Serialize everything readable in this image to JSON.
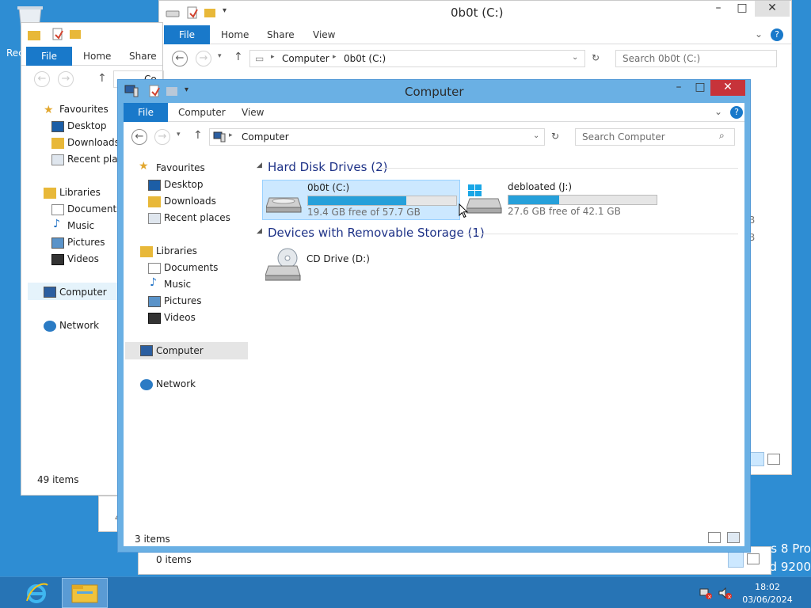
{
  "desktop": {
    "recycle_bin_label": "Rec",
    "watermark_line1": "s 8 Pro",
    "watermark_line2": "d 9200"
  },
  "back_window_c": {
    "title": "0b0t (C:)",
    "tabs": [
      "File",
      "Home",
      "Share",
      "View"
    ],
    "address": [
      "Computer",
      "0b0t (C:)"
    ],
    "search_placeholder": "Search 0b0t (C:)",
    "fragments": [
      "B",
      "B"
    ]
  },
  "back_window_left": {
    "tabs": [
      "File",
      "Home",
      "Share"
    ],
    "address_fragment": "Co",
    "nav": {
      "favourites": "Favourites",
      "fav_items": [
        "Desktop",
        "Downloads",
        "Recent place"
      ],
      "libraries": "Libraries",
      "lib_items": [
        "Documents",
        "Music",
        "Pictures",
        "Videos"
      ],
      "computer": "Computer",
      "network": "Network"
    },
    "status": "49 items"
  },
  "back_window_bottom": {
    "status": "0 items",
    "tiny_fragment": "4"
  },
  "main_window": {
    "title": "Computer",
    "tabs": {
      "file": "File",
      "computer": "Computer",
      "view": "View"
    },
    "address": "Computer",
    "search_placeholder": "Search Computer",
    "nav": {
      "favourites": "Favourites",
      "fav_items": [
        "Desktop",
        "Downloads",
        "Recent places"
      ],
      "libraries": "Libraries",
      "lib_items": [
        "Documents",
        "Music",
        "Pictures",
        "Videos"
      ],
      "computer": "Computer",
      "network": "Network"
    },
    "groups": {
      "hdd": "Hard Disk Drives (2)",
      "removable": "Devices with Removable Storage (1)"
    },
    "drives": [
      {
        "name": "0b0t (C:)",
        "free": "19.4 GB free of 57.7 GB",
        "used_fraction": 0.664,
        "selected": true
      },
      {
        "name": "debloated (J:)",
        "free": "27.6 GB free of 42.1 GB",
        "used_fraction": 0.344,
        "selected": false
      }
    ],
    "cd_drive": "CD Drive (D:)",
    "status": "3 items"
  },
  "taskbar": {
    "time": "18:02",
    "date": "03/06/2024"
  },
  "colors": {
    "accent": "#1979ca",
    "bar_fill": "#26a0da",
    "selection": "#cce8ff",
    "titlebar_active": "#6ab0e4",
    "close": "#c7333a",
    "group_header": "#1e3287"
  }
}
